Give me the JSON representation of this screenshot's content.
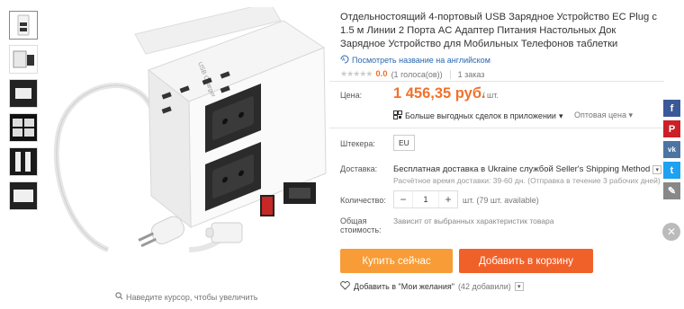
{
  "product": {
    "title": "Отдельностоящий 4-портовый USB Зарядное Устройство EC Plug с 1.5 м Линии 2 Порта AC Адаптер Питания Настольных Док Зарядное Устройство для Мобильных Телефонов таблетки",
    "translate_link": "Посмотреть название на английском",
    "rating_value": "0.0",
    "rating_votes": "(1 голоса(ов))",
    "orders": "1 заказ",
    "zoom_hint": "Наведите курсор, чтобы увеличить"
  },
  "price": {
    "label": "Цена:",
    "value": "1 456,35 руб.",
    "unit": "/ шт.",
    "deals_text": "Больше выгодных сделок в приложении",
    "wholesale_text": "Оптовая цена"
  },
  "plug": {
    "label": "Штекера:",
    "value": "EU"
  },
  "shipping": {
    "label": "Доставка:",
    "main": "Бесплатная доставка в Ukraine службой Seller's Shipping Method",
    "sub": "Расчётное время доставки: 39-60 дн. (Отправка в течение 3 рабочих дней)"
  },
  "quantity": {
    "label": "Количество:",
    "minus": "−",
    "value": "1",
    "plus": "+",
    "note": "шт. (79 шт. available)"
  },
  "total": {
    "label_line1": "Общая",
    "label_line2": "стоимость:",
    "value": "Зависит от выбранных характеристик товара"
  },
  "actions": {
    "buy_now": "Купить сейчас",
    "add_to_cart": "Добавить в корзину",
    "wishlist": "Добавить в \"Мои желания\"",
    "wishlist_count": "(42 добавили)"
  },
  "social": {
    "facebook": "f",
    "pinterest": "P",
    "vk": "vk",
    "twitter": "t",
    "edit": "✎",
    "close": "✕"
  },
  "colors": {
    "price": "#f0722d",
    "buy_now": "#f79c37",
    "add_to_cart": "#f0612a",
    "link": "#2a67b1"
  }
}
